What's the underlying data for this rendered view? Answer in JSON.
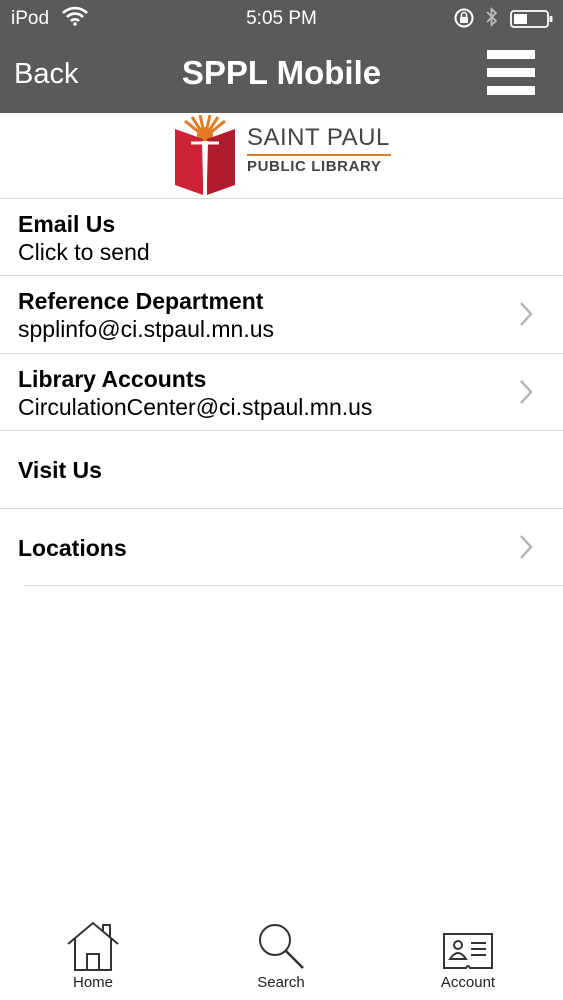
{
  "status_bar": {
    "carrier": "iPod",
    "time": "5:05 PM"
  },
  "nav": {
    "back_label": "Back",
    "title": "SPPL Mobile"
  },
  "logo": {
    "line1": "SAINT PAUL",
    "line2": "PUBLIC LIBRARY"
  },
  "list": [
    {
      "label": "Email Us",
      "sub": "Click to send",
      "chevron": false
    },
    {
      "label": "Reference Department",
      "sub": "spplinfo@ci.stpaul.mn.us",
      "chevron": true
    },
    {
      "label": "Library Accounts",
      "sub": "CirculationCenter@ci.stpaul.mn.us",
      "chevron": true
    },
    {
      "label": "Visit Us",
      "sub": "",
      "chevron": false
    },
    {
      "label": "Locations",
      "sub": "",
      "chevron": true
    }
  ],
  "tabs": [
    {
      "label": "Home",
      "icon": "home-icon"
    },
    {
      "label": "Search",
      "icon": "search-icon"
    },
    {
      "label": "Account",
      "icon": "account-card-icon"
    }
  ],
  "colors": {
    "nav_bg": "#5a5a5a",
    "logo_red": "#cc2136",
    "logo_orange": "#e37b22"
  }
}
